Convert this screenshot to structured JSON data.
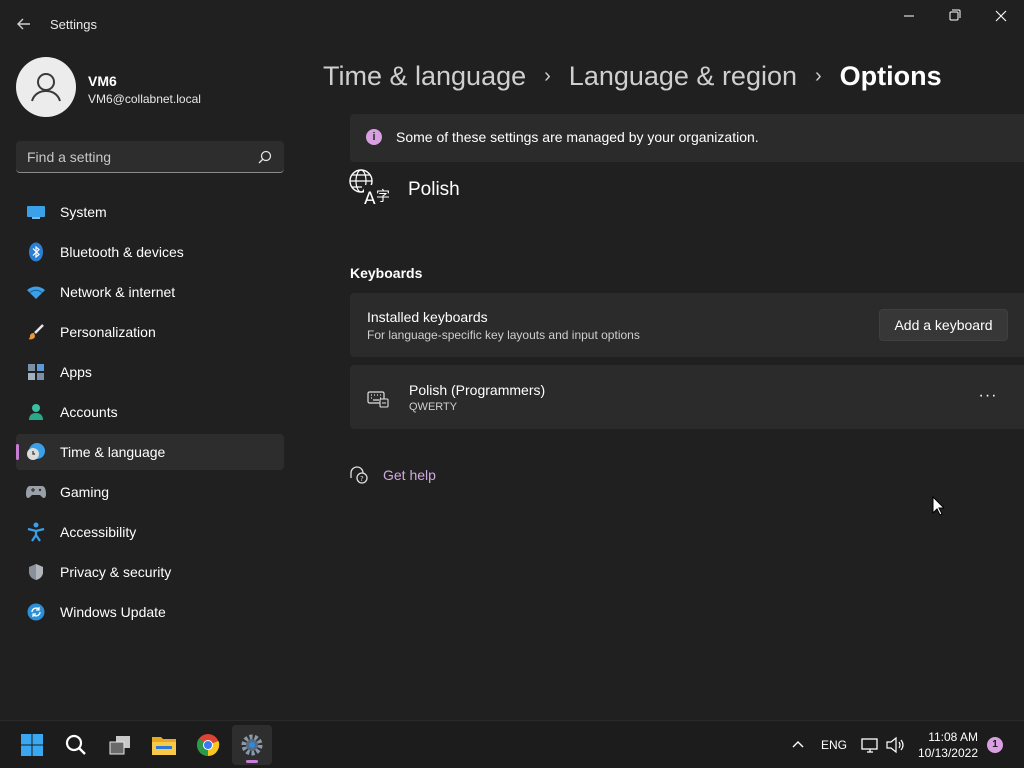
{
  "window": {
    "title": "Settings",
    "back_icon": "arrow-left-icon",
    "controls": [
      "minimize-icon",
      "maximize-icon",
      "close-icon"
    ]
  },
  "profile": {
    "name": "VM6",
    "email": "VM6@collabnet.local",
    "avatar_icon": "user-icon"
  },
  "search": {
    "placeholder": "Find a setting",
    "icon": "search-icon"
  },
  "sidebar": {
    "items": [
      {
        "label": "System",
        "icon": "system-icon"
      },
      {
        "label": "Bluetooth & devices",
        "icon": "bluetooth-icon"
      },
      {
        "label": "Network & internet",
        "icon": "wifi-icon"
      },
      {
        "label": "Personalization",
        "icon": "brush-icon"
      },
      {
        "label": "Apps",
        "icon": "apps-icon"
      },
      {
        "label": "Accounts",
        "icon": "accounts-icon"
      },
      {
        "label": "Time & language",
        "icon": "time-language-icon",
        "selected": true
      },
      {
        "label": "Gaming",
        "icon": "gamepad-icon"
      },
      {
        "label": "Accessibility",
        "icon": "accessibility-icon"
      },
      {
        "label": "Privacy & security",
        "icon": "shield-icon"
      },
      {
        "label": "Windows Update",
        "icon": "update-icon"
      }
    ]
  },
  "breadcrumb": {
    "items": [
      "Time & language",
      "Language & region"
    ],
    "current": "Options",
    "separator": "›"
  },
  "org_banner": {
    "text": "Some of these settings are managed by your organization.",
    "icon": "info-icon"
  },
  "language": {
    "name": "Polish",
    "icon": "language-icon"
  },
  "keyboards": {
    "section_title": "Keyboards",
    "installed": {
      "title": "Installed keyboards",
      "subtitle": "For language-specific key layouts and input options",
      "button": "Add a keyboard"
    },
    "list": [
      {
        "name": "Polish (Programmers)",
        "layout": "QWERTY",
        "icon": "keyboard-icon",
        "more": "···"
      }
    ]
  },
  "help": {
    "label": "Get help",
    "icon": "help-icon"
  },
  "taskbar": {
    "apps": [
      "windows-start-icon",
      "search-icon",
      "task-view-icon",
      "file-explorer-icon",
      "chrome-icon",
      "settings-icon"
    ],
    "active_app": "settings-icon",
    "language": "ENG",
    "time": "11:08 AM",
    "date": "10/13/2022",
    "notification_count": "1"
  },
  "colors": {
    "accent": "#c77dd6",
    "background": "#202020",
    "card": "#2b2b2b"
  }
}
